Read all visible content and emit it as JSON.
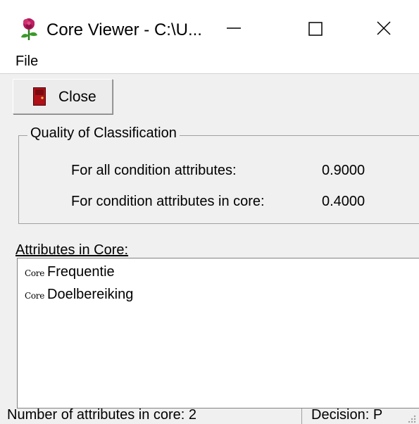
{
  "window": {
    "title": "Core Viewer - C:\\U...",
    "icon": "rose-icon"
  },
  "menu": {
    "file_label": "File"
  },
  "toolbar": {
    "close_label": "Close",
    "close_icon": "door-icon"
  },
  "quality": {
    "group_title": "Quality of Classification",
    "rows": [
      {
        "label": "For all condition attributes:",
        "value": "0.9000"
      },
      {
        "label": "For condition attributes in core:",
        "value": "0.4000"
      }
    ]
  },
  "attributes": {
    "label": "Attributes in Core:",
    "items": [
      {
        "tag": "Core",
        "name": "Frequentie"
      },
      {
        "tag": "Core",
        "name": "Doelbereiking"
      }
    ]
  },
  "status": {
    "left": "Number of attributes in core: 2",
    "right": "Decision: P"
  },
  "colors": {
    "window_bg": "#f0f0f0",
    "door_icon": "#b01018"
  }
}
